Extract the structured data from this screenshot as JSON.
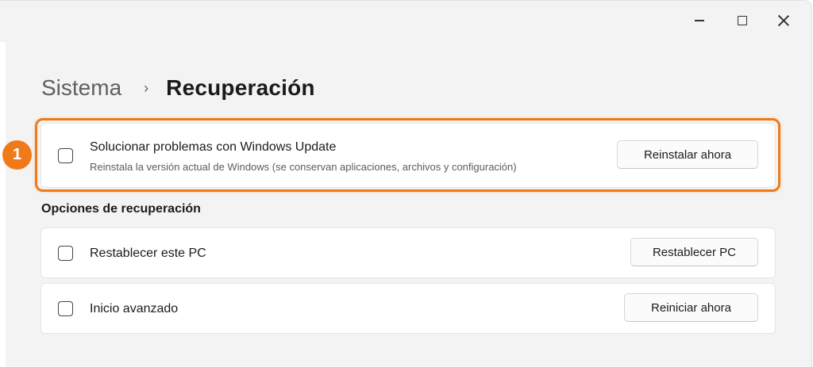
{
  "window": {
    "controls": {
      "minimize": "minimize-icon",
      "maximize": "maximize-icon",
      "close": "close-icon"
    }
  },
  "breadcrumb": {
    "parent": "Sistema",
    "separator": "›",
    "current": "Recuperación"
  },
  "step_badge": "1",
  "highlight_color": "#f07a1a",
  "highlighted_item": {
    "icon": "checkbox-icon",
    "title": "Solucionar problemas con Windows Update",
    "subtitle": "Reinstala la versión actual de Windows (se conservan aplicaciones, archivos y configuración)",
    "button": "Reinstalar ahora"
  },
  "recovery_section": {
    "title": "Opciones de recuperación",
    "items": [
      {
        "icon": "checkbox-icon",
        "title": "Restablecer este PC",
        "button": "Restablecer PC"
      },
      {
        "icon": "checkbox-icon",
        "title": "Inicio avanzado",
        "button": "Reiniciar ahora"
      }
    ]
  }
}
